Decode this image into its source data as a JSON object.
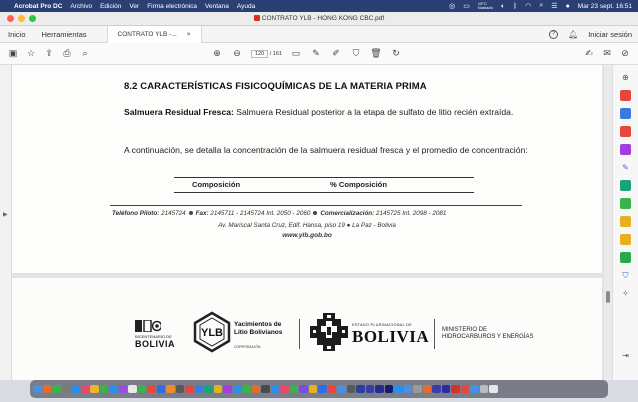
{
  "menubar": {
    "app": "Acrobat Pro DC",
    "items": [
      "Archivo",
      "Edición",
      "Ver",
      "Firma electrónica",
      "Ventana",
      "Ayuda"
    ],
    "weather_temp": "15°C",
    "weather_desc": "Nublado",
    "datetime": "Mar 23 sept. 16:51"
  },
  "window": {
    "title": "CONTRATO YLB - HONG KONG CBC.pdf"
  },
  "tabbar": {
    "home": "Inicio",
    "tools": "Herramientas",
    "doc_tab": "CONTRATO YLB -...",
    "close": "×",
    "help": "?",
    "signin": "Iniciar sesión"
  },
  "toolbar": {
    "page_current": "120",
    "page_sep": "/",
    "page_total": "161"
  },
  "document": {
    "heading": "8.2   CARACTERÍSTICAS FISICOQUÍMICAS DE LA MATERIA PRIMA",
    "para1_bold": "Salmuera Residual Fresca:",
    "para1_text": " Salmuera Residual posterior a la etapa de sulfato de litio recién extraída.",
    "para2": "A continuación, se detalla la concentración de la salmuera residual fresca y el promedio de concentración:",
    "col1": "Composición",
    "col2": "% Composición",
    "footer_tel_label": "Teléfono Piloto:",
    "footer_tel": " 2145724",
    "footer_fax_label": "Fax:",
    "footer_fax": " 2145711 - 2145724 Int. 2050 - 2060",
    "footer_com_label": "Comercialización:",
    "footer_com": " 2145725 Int. 2098 - 2081",
    "footer_addr": "Av. Mariscal Santa Cruz, Edif. Hansa, piso 19  ●  La Paz - Bolivia",
    "footer_web": "www.ylb.gob.bo"
  },
  "logos": {
    "bolivia1_sub": "BICENTENARIO DE",
    "bolivia1": "BOLIVIA",
    "ylb_initials": "YLB",
    "ylb_name": "Yacimientos de\nLitio Bolivianos",
    "ylb_sub": "CORPORACIÓN",
    "estado": "ESTADO PLURINACIONAL DE",
    "bolivia_big": "BOLIVIA",
    "ministerio": "MINISTERIO DE\nHIDROCARBUROS Y ENERGÍAS"
  },
  "colors": {
    "menubar": "#2a3f73",
    "accent_red": "#d93025"
  }
}
